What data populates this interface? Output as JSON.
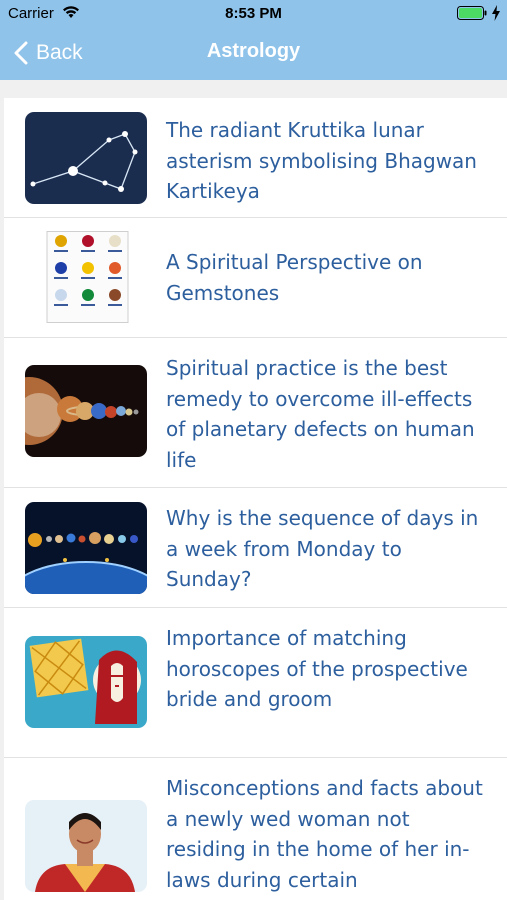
{
  "status_bar": {
    "carrier": "Carrier",
    "time": "8:53 PM",
    "wifi_icon": "wifi-icon",
    "battery_icon": "battery-icon",
    "charging_icon": "charging-bolt-icon"
  },
  "nav": {
    "back_label": "Back",
    "title": "Astrology",
    "back_icon": "chevron-left-icon"
  },
  "theme": {
    "header_bg": "#8fc3ea",
    "title_color": "#2d5f9e",
    "battery_fill": "#4cd964"
  },
  "articles": [
    {
      "title": "The radiant Kruttika lunar asterism symbolising Bhagwan Kartikeya",
      "thumbnail": "constellation-image"
    },
    {
      "title": "A Spiritual Perspective on Gemstones",
      "thumbnail": "gemstones-chart-image"
    },
    {
      "title": "Spiritual practice is the best remedy to overcome ill-effects of planetary defects on human life",
      "thumbnail": "planets-image"
    },
    {
      "title": "Why is the sequence of days in a week from Monday to Sunday?",
      "thumbnail": "solar-system-image"
    },
    {
      "title": "Importance of matching horoscopes of the prospective bride and groom",
      "thumbnail": "horoscope-chart-image"
    },
    {
      "title": "Misconceptions and facts about a newly wed woman not residing in the home of her in-laws during certain",
      "thumbnail": "woman-portrait-image"
    }
  ]
}
